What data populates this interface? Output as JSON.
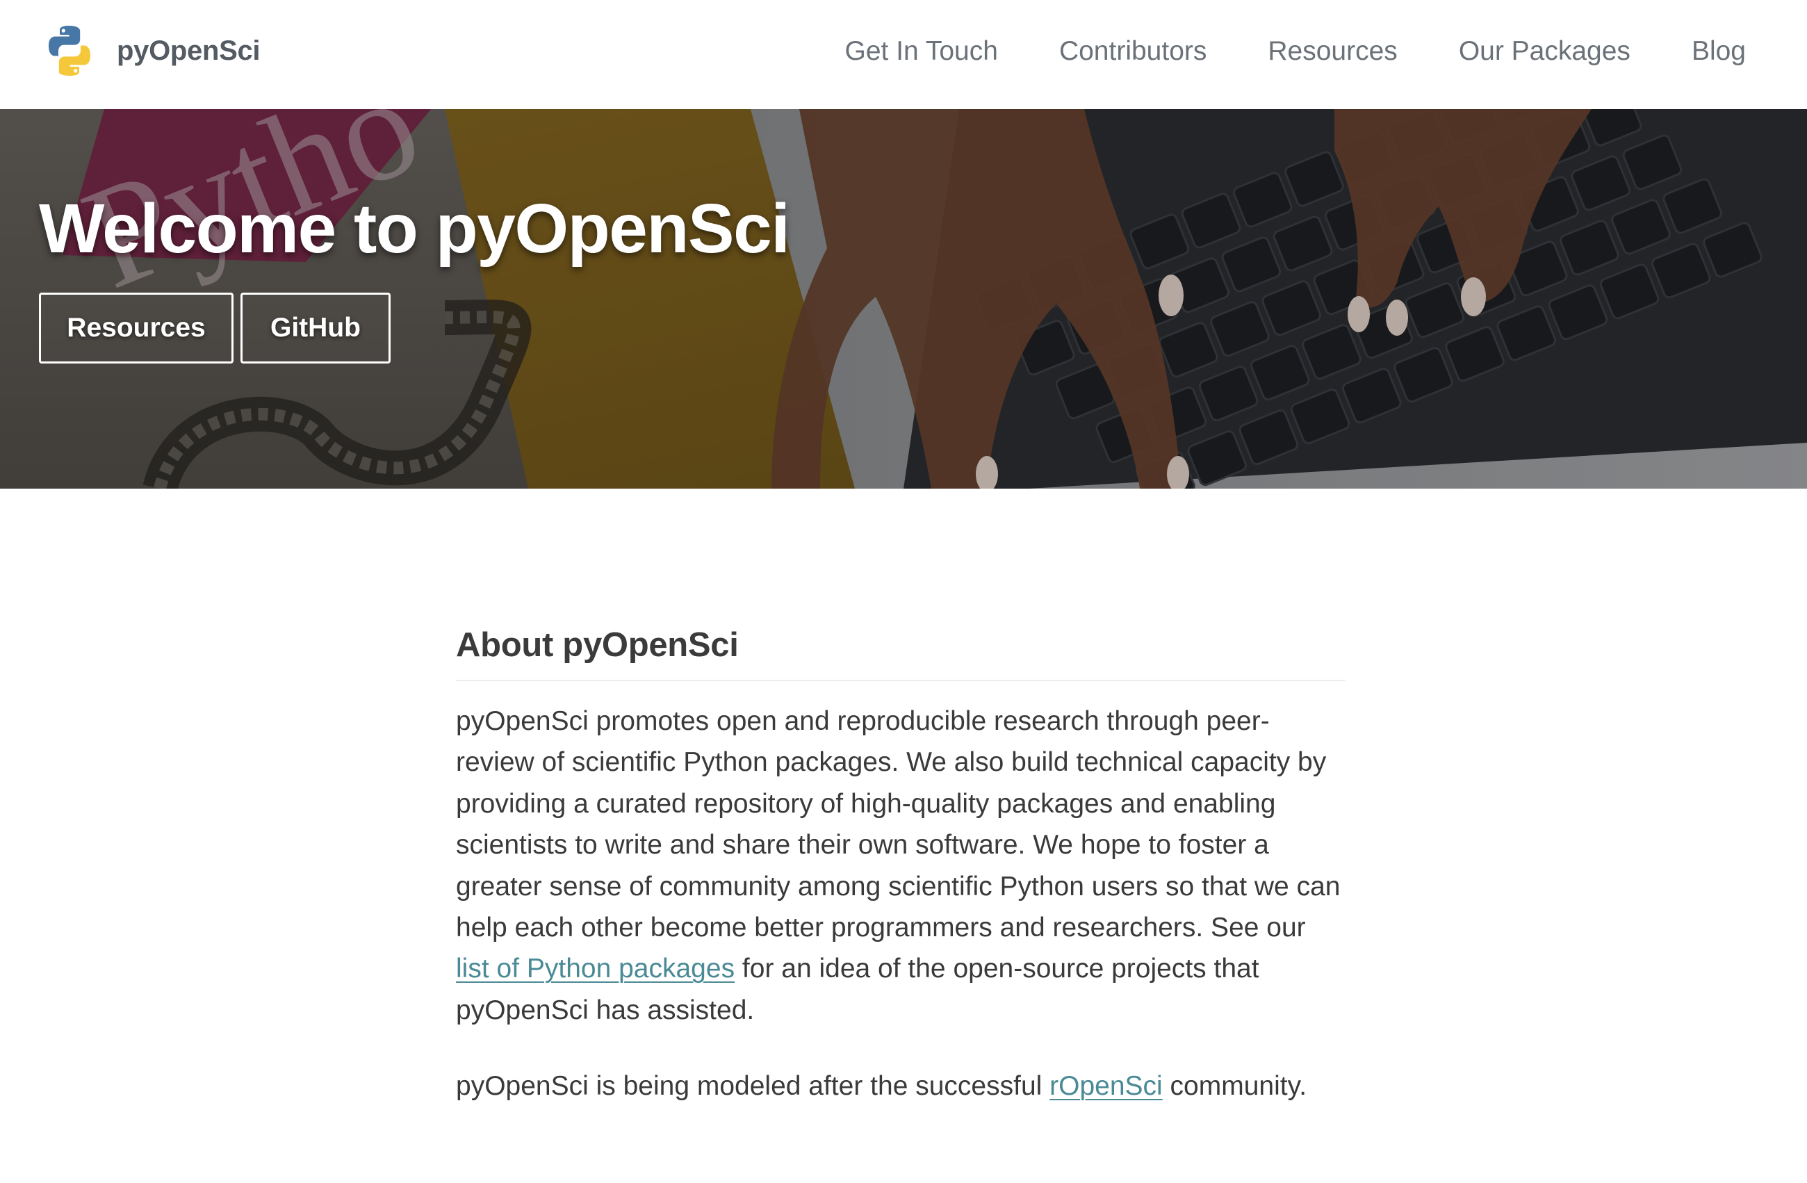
{
  "brand": {
    "name": "pyOpenSci",
    "logo_icon": "python-logo-icon"
  },
  "nav": {
    "items": [
      {
        "label": "Get In Touch"
      },
      {
        "label": "Contributors"
      },
      {
        "label": "Resources"
      },
      {
        "label": "Our Packages"
      },
      {
        "label": "Blog"
      }
    ]
  },
  "hero": {
    "title": "Welcome to pyOpenSci",
    "buttons": {
      "resources": "Resources",
      "github": "GitHub"
    },
    "background_description_icon": "laptop-keyboard-hands-photo"
  },
  "about": {
    "heading": "About pyOpenSci",
    "paragraph1": {
      "text_before_link": "pyOpenSci promotes open and reproducible research through peer-review of scientific Python packages. We also build technical capacity by providing a curated repository of high-quality packages and enabling scientists to write and share their own software. We hope to foster a greater sense of community among scientific Python users so that we can help each other become better programmers and researchers. See our ",
      "link_text": "list of Python packages",
      "text_after_link": " for an idea of the open-source projects that pyOpenSci has assisted."
    },
    "paragraph2": {
      "text_before_link": "pyOpenSci is being modeled after the successful ",
      "link_text": "rOpenSci",
      "text_after_link": " community."
    }
  },
  "colors": {
    "link": "#4a8a96",
    "nav_text": "#6b7178",
    "brand_text": "#555b63",
    "body_text": "#3a3a3a"
  }
}
